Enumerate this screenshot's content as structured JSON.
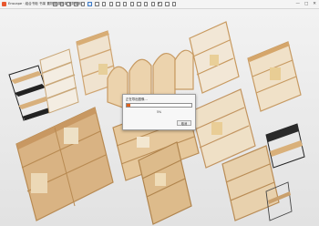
{
  "window": {
    "app_name": "Enscape",
    "title": "组合书柜 书架 置物架 展示架 置物架柜",
    "minimize": "—",
    "maximize": "□",
    "close": "✕"
  },
  "toolbar": {
    "icons": [
      "home-icon",
      "open-icon",
      "save-icon",
      "undo-icon",
      "redo-icon",
      "visual-settings-icon",
      "views-icon",
      "screenshot-icon",
      "batch-render-icon",
      "panorama-icon",
      "video-icon",
      "export-icon",
      "asset-library-icon",
      "material-icon",
      "upload-icon",
      "settings-icon",
      "feedback-icon",
      "help-icon"
    ],
    "accent_color": "#3a78c4"
  },
  "dialog": {
    "title": "正在导出图像…",
    "progress": 0.05,
    "percent_text": "5%",
    "cancel_label": "取消",
    "progress_color": "#e0621d"
  }
}
